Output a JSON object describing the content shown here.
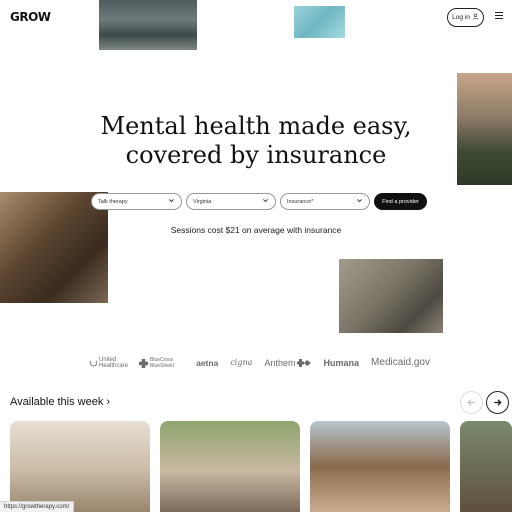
{
  "header": {
    "logo": "GROW",
    "login_label": "Log in"
  },
  "hero": {
    "title_line1": "Mental health made easy,",
    "title_line2": "covered by insurance"
  },
  "search": {
    "therapy_type": "Talk therapy",
    "state": "Virginia",
    "insurance": "Insurance*",
    "find_button": "Find a provider"
  },
  "sessions_note": "Sessions cost $21 on average with insurance",
  "insurance_logos": [
    {
      "name": "United Healthcare"
    },
    {
      "name": "BlueCross BlueShield"
    },
    {
      "name": "aetna"
    },
    {
      "name": "cigna"
    },
    {
      "name": "Anthem"
    },
    {
      "name": "Humana"
    },
    {
      "name": "Medicaid.gov"
    }
  ],
  "providers": {
    "title": "Available this week",
    "title_chevron": "›"
  },
  "status_bar": {
    "url": "https://growtherapy.com/"
  }
}
